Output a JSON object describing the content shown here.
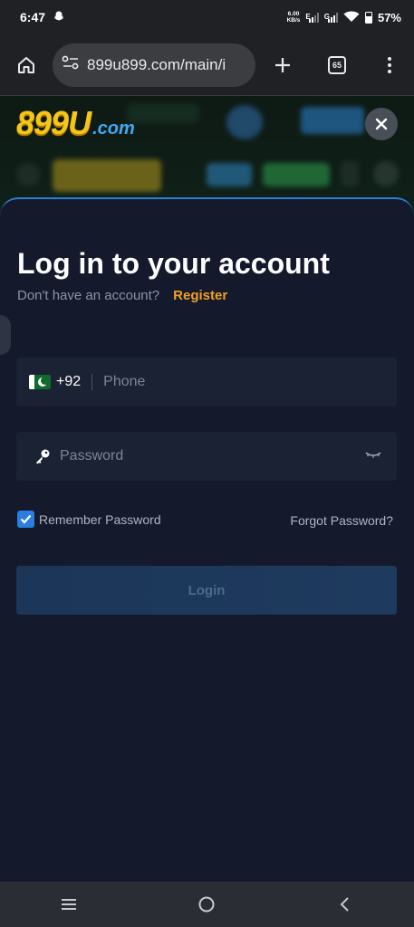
{
  "status_bar": {
    "time": "6:47",
    "net_speed_value": "6.00",
    "net_speed_unit": "KB/s",
    "signal1_label": "E",
    "signal2_label": "G",
    "battery": "57%"
  },
  "browser": {
    "url": "899u899.com/main/i",
    "tab_count": "65"
  },
  "site": {
    "logo_main": "899U",
    "logo_domain": ".com"
  },
  "login": {
    "title": "Log in to your account",
    "no_account": "Don't have an account?",
    "register": "Register",
    "country_code": "+92",
    "phone_placeholder": "Phone",
    "password_placeholder": "Password",
    "remember": "Remember Password",
    "forgot": "Forgot Password?",
    "login_button": "Login"
  },
  "colors": {
    "accent_orange": "#f0a028",
    "accent_blue": "#2b7de0",
    "background": "#141a2b"
  }
}
